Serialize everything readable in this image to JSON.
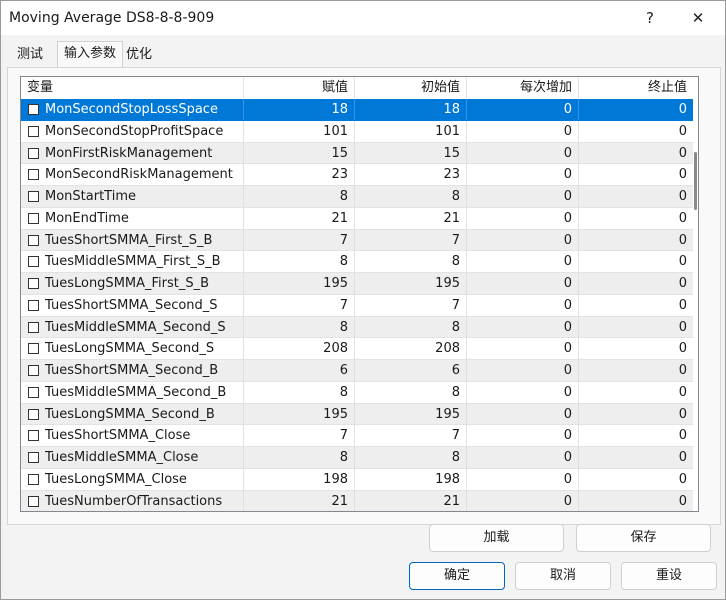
{
  "window": {
    "title": "Moving Average DS8-8-8-909",
    "help_glyph": "?",
    "close_glyph": "✕"
  },
  "tabs": [
    {
      "label": "测试"
    },
    {
      "label": "输入参数"
    },
    {
      "label": "优化"
    }
  ],
  "active_tab": 1,
  "table": {
    "columns": [
      "变量",
      "赋值",
      "初始值",
      "每次增加",
      "终止值"
    ],
    "rows": [
      {
        "name": "MonSecondStopLossSpace",
        "value": "18",
        "start": "18",
        "step": "0",
        "stop": "0",
        "checked": false
      },
      {
        "name": "MonSecondStopProfitSpace",
        "value": "101",
        "start": "101",
        "step": "0",
        "stop": "0",
        "checked": false
      },
      {
        "name": "MonFirstRiskManagement",
        "value": "15",
        "start": "15",
        "step": "0",
        "stop": "0",
        "checked": false
      },
      {
        "name": "MonSecondRiskManagement",
        "value": "23",
        "start": "23",
        "step": "0",
        "stop": "0",
        "checked": false
      },
      {
        "name": "MonStartTime",
        "value": "8",
        "start": "8",
        "step": "0",
        "stop": "0",
        "checked": false
      },
      {
        "name": "MonEndTime",
        "value": "21",
        "start": "21",
        "step": "0",
        "stop": "0",
        "checked": false
      },
      {
        "name": "TuesShortSMMA_First_S_B",
        "value": "7",
        "start": "7",
        "step": "0",
        "stop": "0",
        "checked": false
      },
      {
        "name": "TuesMiddleSMMA_First_S_B",
        "value": "8",
        "start": "8",
        "step": "0",
        "stop": "0",
        "checked": false
      },
      {
        "name": "TuesLongSMMA_First_S_B",
        "value": "195",
        "start": "195",
        "step": "0",
        "stop": "0",
        "checked": false
      },
      {
        "name": "TuesShortSMMA_Second_S",
        "value": "7",
        "start": "7",
        "step": "0",
        "stop": "0",
        "checked": false
      },
      {
        "name": "TuesMiddleSMMA_Second_S",
        "value": "8",
        "start": "8",
        "step": "0",
        "stop": "0",
        "checked": false
      },
      {
        "name": "TuesLongSMMA_Second_S",
        "value": "208",
        "start": "208",
        "step": "0",
        "stop": "0",
        "checked": false
      },
      {
        "name": "TuesShortSMMA_Second_B",
        "value": "6",
        "start": "6",
        "step": "0",
        "stop": "0",
        "checked": false
      },
      {
        "name": "TuesMiddleSMMA_Second_B",
        "value": "8",
        "start": "8",
        "step": "0",
        "stop": "0",
        "checked": false
      },
      {
        "name": "TuesLongSMMA_Second_B",
        "value": "195",
        "start": "195",
        "step": "0",
        "stop": "0",
        "checked": false
      },
      {
        "name": "TuesShortSMMA_Close",
        "value": "7",
        "start": "7",
        "step": "0",
        "stop": "0",
        "checked": false
      },
      {
        "name": "TuesMiddleSMMA_Close",
        "value": "8",
        "start": "8",
        "step": "0",
        "stop": "0",
        "checked": false
      },
      {
        "name": "TuesLongSMMA_Close",
        "value": "198",
        "start": "198",
        "step": "0",
        "stop": "0",
        "checked": false
      },
      {
        "name": "TuesNumberOfTransactions",
        "value": "21",
        "start": "21",
        "step": "0",
        "stop": "0",
        "checked": false
      }
    ],
    "selected_row": 0
  },
  "buttons": {
    "load": "加载",
    "save": "保存",
    "ok": "确定",
    "cancel": "取消",
    "reset": "重设"
  },
  "colors": {
    "selection": "#0078d7",
    "alt_row": "#eeeeee"
  }
}
